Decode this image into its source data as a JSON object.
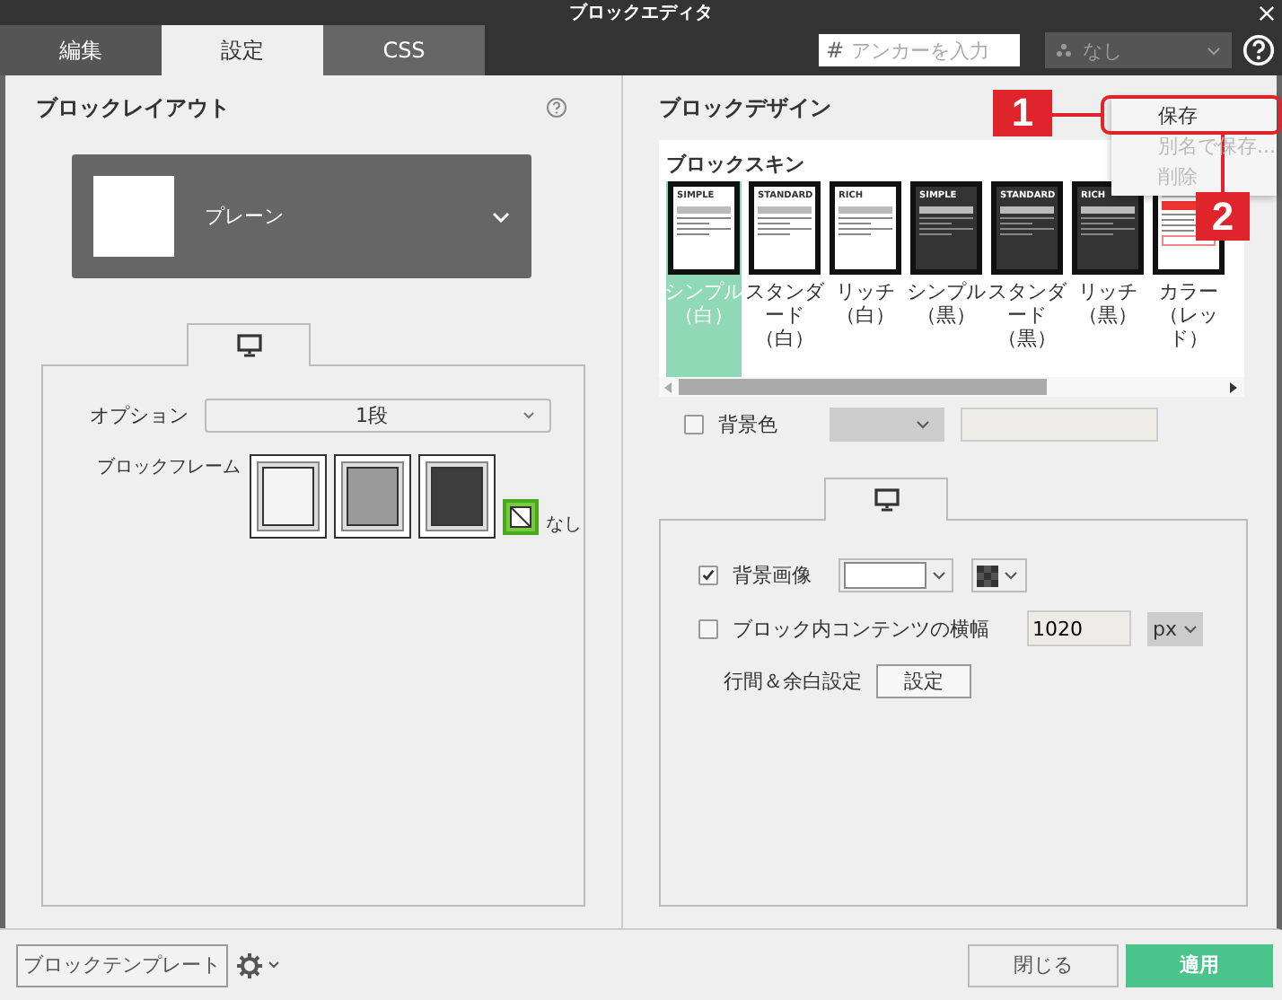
{
  "window": {
    "title": "ブロックエディタ"
  },
  "tabs": [
    {
      "label": "編集",
      "selected": false
    },
    {
      "label": "設定",
      "selected": true
    },
    {
      "label": "CSS",
      "selected": false
    }
  ],
  "anchor_field": {
    "prefix": "#",
    "placeholder": "アンカーを入力"
  },
  "category_select": {
    "value": "なし",
    "disabled": true
  },
  "left": {
    "title": "ブロックレイアウト",
    "layout_select": {
      "value": "プレーン"
    },
    "option": {
      "label": "オプション",
      "value": "1段"
    },
    "frame": {
      "label": "ブロックフレーム",
      "none_label": "なし",
      "frames": [
        {
          "kind": "light",
          "selected": false
        },
        {
          "kind": "mid",
          "selected": false
        },
        {
          "kind": "dark",
          "selected": false
        },
        {
          "kind": "none",
          "selected": true
        }
      ]
    }
  },
  "right": {
    "title": "ブロックデザイン",
    "skin_title": "ブロックスキン",
    "skins": [
      {
        "label": "シンプル（白）",
        "kind": "light",
        "heading": "SIMPLE",
        "selected": true
      },
      {
        "label": "スタンダード（白）",
        "kind": "light",
        "heading": "STANDARD",
        "selected": false
      },
      {
        "label": "リッチ（白）",
        "kind": "light",
        "heading": "RICH",
        "selected": false
      },
      {
        "label": "シンプル（黒）",
        "kind": "dark",
        "heading": "SIMPLE",
        "selected": false
      },
      {
        "label": "スタンダード（黒）",
        "kind": "dark",
        "heading": "STANDARD",
        "selected": false
      },
      {
        "label": "リッチ（黒）",
        "kind": "dark",
        "heading": "RICH",
        "selected": false
      },
      {
        "label": "カラー（レッド）",
        "kind": "color",
        "selected": false
      }
    ],
    "bg_color": {
      "label": "背景色",
      "checked": false
    },
    "bg_image": {
      "label": "背景画像",
      "checked": true
    },
    "content_width": {
      "label": "ブロック内コンテンツの横幅",
      "checked": false,
      "value": "1020",
      "unit": "px"
    },
    "spacing": {
      "label": "行間＆余白設定",
      "button": "設定"
    }
  },
  "menu": [
    {
      "label": "保存",
      "disabled": false
    },
    {
      "label": "別名で保存...",
      "disabled": true
    },
    {
      "label": "削除",
      "disabled": true
    }
  ],
  "callouts": [
    "1",
    "2"
  ],
  "footer": {
    "template_button": "ブロックテンプレート",
    "close": "閉じる",
    "apply": "適用"
  }
}
